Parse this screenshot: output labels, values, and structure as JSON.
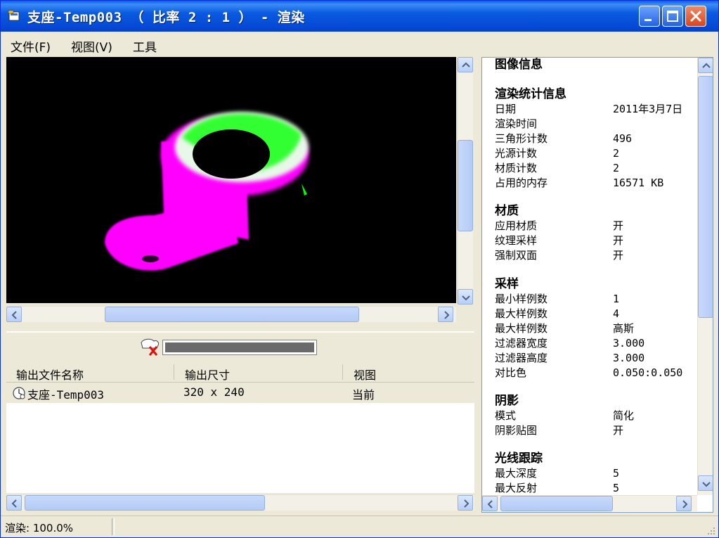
{
  "window": {
    "title": "支座-Temp003 （ 比率 2 : 1 ） - 渲染",
    "icon": "app-icon"
  },
  "menu": {
    "items": [
      "文件(F)",
      "视图(V)",
      "工具"
    ]
  },
  "output_list": {
    "columns": [
      "输出文件名称",
      "输出尺寸",
      "视图"
    ],
    "rows": [
      {
        "name": "支座-Temp003",
        "size": "320 x 240",
        "view": "当前",
        "icon": "render-file-icon"
      }
    ]
  },
  "progress": {
    "percent": 100,
    "icon": "cancel-render-icon"
  },
  "info": {
    "title": "图像信息",
    "sections": [
      {
        "heading": "渲染统计信息",
        "rows": [
          {
            "label": "日期",
            "value": "2011年3月7日"
          },
          {
            "label": "渲染时间",
            "value": ""
          },
          {
            "label": "三角形计数",
            "value": "496"
          },
          {
            "label": "光源计数",
            "value": "2"
          },
          {
            "label": "材质计数",
            "value": "2"
          },
          {
            "label": "占用的内存",
            "value": "16571 KB"
          }
        ]
      },
      {
        "heading": "材质",
        "rows": [
          {
            "label": "应用材质",
            "value": "开"
          },
          {
            "label": "纹理采样",
            "value": "开"
          },
          {
            "label": "强制双面",
            "value": "开"
          }
        ]
      },
      {
        "heading": "采样",
        "rows": [
          {
            "label": "最小样例数",
            "value": "1"
          },
          {
            "label": "最大样例数",
            "value": "4"
          },
          {
            "label": "最大样例数",
            "value": "高斯"
          },
          {
            "label": "过滤器宽度",
            "value": "3.000"
          },
          {
            "label": "过滤器高度",
            "value": "3.000"
          },
          {
            "label": "对比色",
            "value": "0.050:0.050"
          }
        ]
      },
      {
        "heading": "阴影",
        "rows": [
          {
            "label": "模式",
            "value": "简化"
          },
          {
            "label": "阴影贴图",
            "value": "开"
          }
        ]
      },
      {
        "heading": "光线跟踪",
        "rows": [
          {
            "label": "最大深度",
            "value": "5"
          },
          {
            "label": "最大反射",
            "value": "5"
          }
        ]
      }
    ]
  },
  "status": {
    "text": "渲染: 100.0%"
  },
  "colors": {
    "titlebar": "#0a5ae0",
    "render_bg": "#000000",
    "model_magenta": "#ff00ff",
    "model_green": "#00ff00"
  }
}
